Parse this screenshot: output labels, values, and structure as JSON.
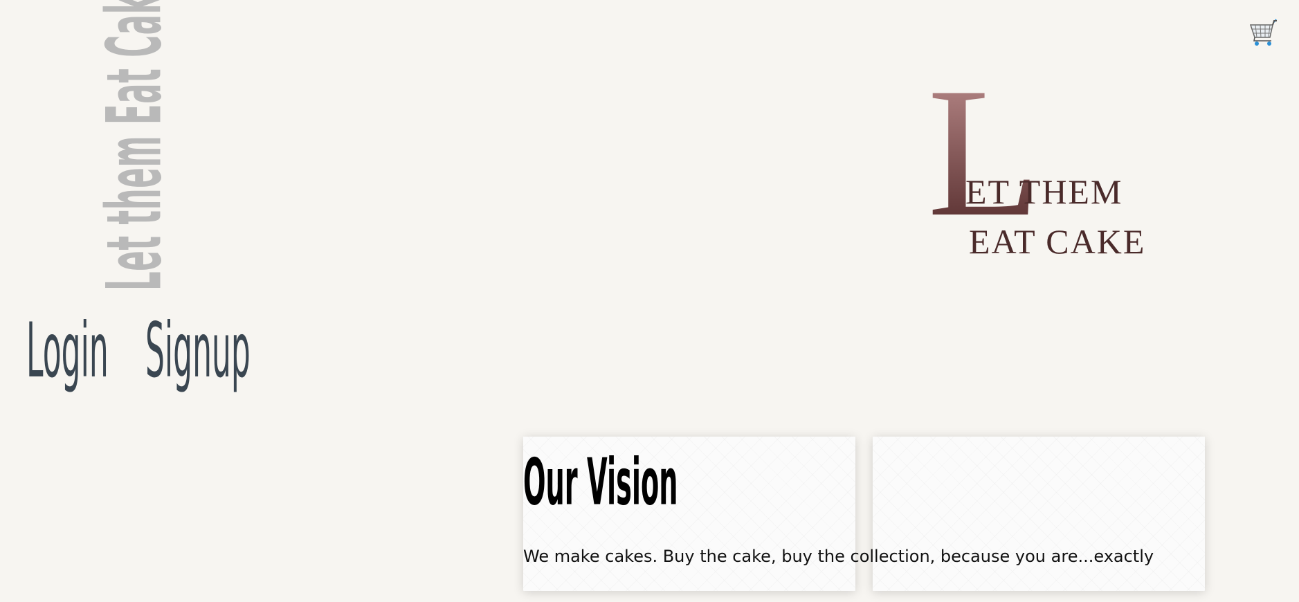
{
  "brand": {
    "vertical_title": "Let them Eat Cake"
  },
  "nav": {
    "login_label": "Login",
    "signup_label": "Signup"
  },
  "logo": {
    "big_letter": "L",
    "line1": "ET THEM",
    "line2": "EAT CAKE"
  },
  "cart": {
    "icon": "shopping-cart-icon"
  },
  "vision": {
    "title": "Our Vision",
    "text": "We make cakes. Buy the cake, buy the collection, because you are...exactly"
  },
  "colors": {
    "background": "#f7f5f1",
    "nav_text": "#3a4651",
    "vertical_brand": "#b9b9b9",
    "logo_dark": "#4a2a2a",
    "logo_rose": "#c49494",
    "cart_blue": "#2a8fd6"
  }
}
